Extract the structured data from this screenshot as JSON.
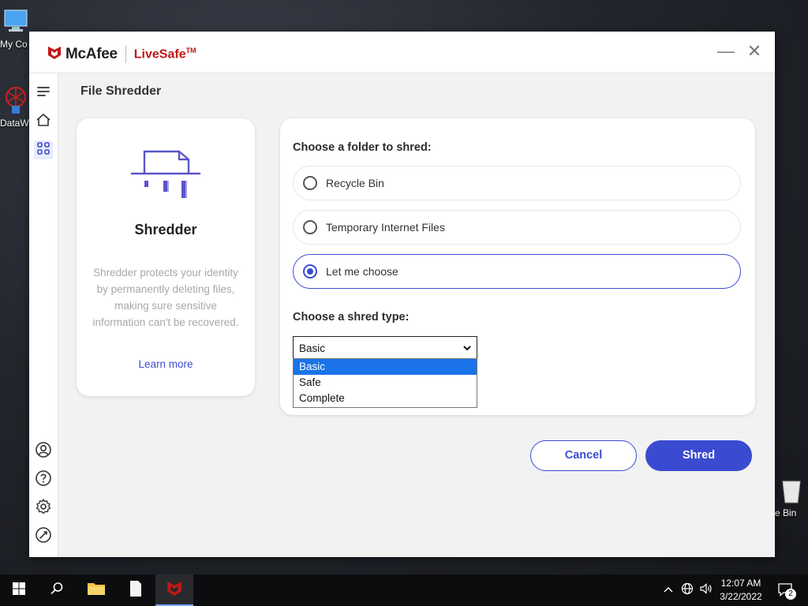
{
  "desktop": {
    "icons": [
      {
        "label": "My Co",
        "icon": "computer-icon"
      },
      {
        "label": "DataW",
        "icon": "datawarehouse-icon"
      },
      {
        "label": "e Bin",
        "icon": "recycle-bin-icon"
      }
    ]
  },
  "app": {
    "brand": "McAfee",
    "product": "LiveSafe",
    "trademark": "TM",
    "accent_color": "#3b4bd1",
    "brand_color": "#c01818"
  },
  "window_controls": {
    "minimize": "—",
    "close": "✕"
  },
  "rail": {
    "top_items": [
      "menu-icon",
      "home-icon",
      "apps-grid-icon"
    ],
    "bottom_items": [
      "account-icon",
      "help-icon",
      "settings-icon",
      "feedback-icon"
    ]
  },
  "page": {
    "title": "File Shredder"
  },
  "info_card": {
    "title": "Shredder",
    "description": "Shredder protects your identity by permanently deleting files, making sure sensitive information can't be recovered.",
    "learn_more": "Learn more"
  },
  "folder_section": {
    "label": "Choose a folder to shred:",
    "options": [
      {
        "label": "Recycle Bin",
        "selected": false
      },
      {
        "label": "Temporary Internet Files",
        "selected": false
      },
      {
        "label": "Let me choose",
        "selected": true
      }
    ]
  },
  "shred_type": {
    "label": "Choose a shred type:",
    "selected": "Basic",
    "options": [
      "Basic",
      "Safe",
      "Complete"
    ],
    "highlighted": "Basic"
  },
  "buttons": {
    "cancel": "Cancel",
    "shred": "Shred"
  },
  "taskbar": {
    "time": "12:07 AM",
    "date": "3/22/2022",
    "notifications": "2"
  }
}
